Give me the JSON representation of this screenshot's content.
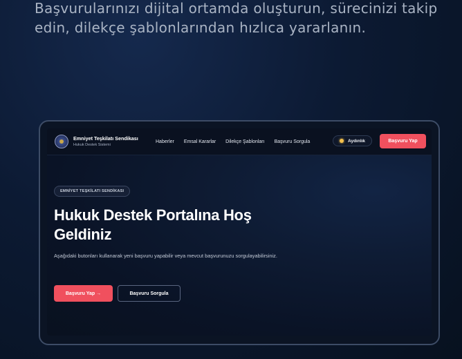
{
  "intro": {
    "text": "Başvurularınızı dijital ortamda oluşturun, sürecinizi takip edin, dilekçe şablonlarından hızlıca yararlanın."
  },
  "site": {
    "brand_title": "Emniyet Teşkilatı Sendikası",
    "brand_subtitle": "Hukuk Destek Sistemi",
    "nav": [
      "Haberler",
      "Emsal Kararlar",
      "Dilekçe Şablonları",
      "Başvuru Sorgula"
    ],
    "theme_toggle": "Aydınlık",
    "cta_top": "Başvuru Yap"
  },
  "hero": {
    "badge": "EMNİYET TEŞKİLATI SENDİKASI",
    "title": "Hukuk Destek Portalına Hoş Geldiniz",
    "description": "Aşağıdaki butonları kullanarak yeni başvuru yapabilir veya mevcut başvurunuzu sorgulayabilirsiniz.",
    "primary_button": "Başvuru Yap →",
    "secondary_button": "Başvuru Sorgula"
  },
  "colors": {
    "accent": "#f0505e",
    "background": "#0c1a33",
    "screen": "#0e1b33"
  },
  "icons": {
    "logo": "police-union-emblem-icon",
    "theme": "sun-icon"
  }
}
